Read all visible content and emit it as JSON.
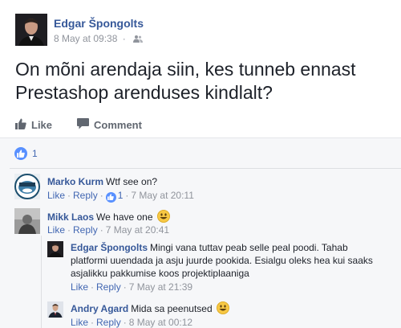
{
  "post": {
    "author": "Edgar Špongolts",
    "timestamp": "8 May at 09:38",
    "privacy_icon": "friends-icon",
    "text": "On mõni arendaja siin, kes tunneb ennast Prestashop arenduses kindlalt?"
  },
  "actions": {
    "like_label": "Like",
    "comment_label": "Comment"
  },
  "reactions": {
    "count": "1"
  },
  "comments": [
    {
      "author": "Marko Kurm",
      "text": "Wtf see on?",
      "like": "Like",
      "reply": "Reply",
      "likes": "1",
      "time": "7 May at 20:11"
    },
    {
      "author": "Mikk Laos",
      "text": "We have one",
      "like": "Like",
      "reply": "Reply",
      "time": "7 May at 20:41"
    },
    {
      "author": "Edgar Špongolts",
      "text": "Mingi vana tuttav peab selle peal poodi. Tahab platformi uuendada ja asju juurde pookida. Esialgu oleks hea kui saaks asjalikku pakkumise koos projektiplaaniga",
      "like": "Like",
      "reply": "Reply",
      "time": "7 May at 21:39"
    },
    {
      "author": "Andry Agard",
      "text": "Mida sa peenutsed",
      "like": "Like",
      "reply": "Reply",
      "time": "8 May at 00:12"
    }
  ],
  "colors": {
    "link": "#365899",
    "muted": "#90949c",
    "like_blue": "#5890ff",
    "feedback_bg": "#f6f7f9"
  }
}
